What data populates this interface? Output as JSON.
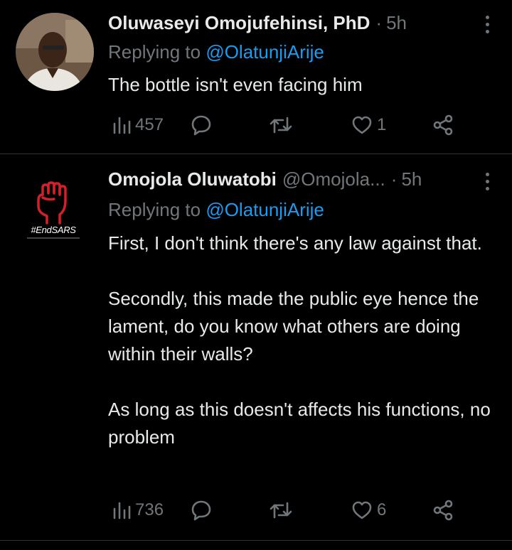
{
  "tweets": [
    {
      "display_name": "Oluwaseyi Omojufehinsi, PhD",
      "handle": "",
      "time": "5h",
      "replying_prefix": "Replying to",
      "replying_to": "@OlatunjiArije",
      "text": "The bottle isn't even facing him",
      "views": "457",
      "replies": "",
      "retweets": "",
      "likes": "1"
    },
    {
      "display_name": "Omojola Oluwatobi",
      "handle": "@Omojola...",
      "time": "5h",
      "replying_prefix": "Replying to",
      "replying_to": "@OlatunjiArije",
      "avatar_label": "#EndSARS",
      "text": "First, I don't think there's any law against that.\n\nSecondly, this made the public eye hence the lament, do you know what others are doing within their walls?\n\nAs long as this doesn't affects his functions, no problem",
      "views": "736",
      "replies": "",
      "retweets": "",
      "likes": "6"
    }
  ],
  "colors": {
    "background": "#000000",
    "text": "#e7e9ea",
    "muted": "#71767b",
    "link": "#1d9bf0",
    "divider": "#2f3336"
  },
  "icons": [
    "views-icon",
    "reply-icon",
    "retweet-icon",
    "like-icon",
    "share-icon",
    "more-icon"
  ]
}
